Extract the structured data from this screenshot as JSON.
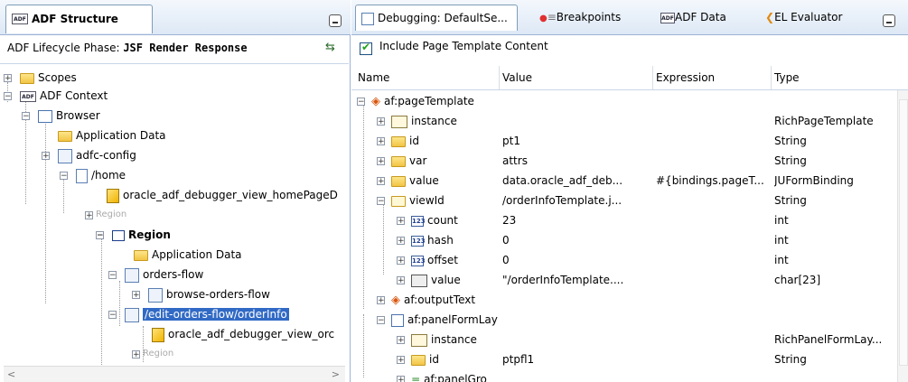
{
  "left_panel": {
    "tab_title": "ADF Structure",
    "phase_label": "ADF Lifecycle Phase:",
    "phase_value": "JSF Render Response",
    "tree": [
      {
        "label": "Scopes"
      },
      {
        "label": "ADF Context"
      },
      {
        "label": "Browser"
      },
      {
        "label": "Application Data"
      },
      {
        "label": "adfc-config"
      },
      {
        "label": "/home"
      },
      {
        "label": "oracle_adf_debugger_view_homePageD"
      },
      {
        "label": "Region"
      },
      {
        "label": "Region"
      },
      {
        "label": "Application Data"
      },
      {
        "label": "orders-flow"
      },
      {
        "label": "browse-orders-flow"
      },
      {
        "label": "/edit-orders-flow/orderInfo"
      },
      {
        "label": "oracle_adf_debugger_view_orc"
      },
      {
        "label": "Region"
      }
    ]
  },
  "right_panel": {
    "tabs": [
      {
        "label": "Debugging: DefaultSe..."
      },
      {
        "label": "Breakpoints"
      },
      {
        "label": "ADF Data"
      },
      {
        "label": "EL Evaluator"
      }
    ],
    "include_label": "Include Page Template Content",
    "columns": {
      "name": "Name",
      "value": "Value",
      "expression": "Expression",
      "type": "Type"
    },
    "rows": [
      {
        "name": "af:pageTemplate",
        "value": "",
        "expression": "",
        "type": ""
      },
      {
        "name": "instance",
        "value": "",
        "expression": "",
        "type": "RichPageTemplate"
      },
      {
        "name": "id",
        "value": "pt1",
        "expression": "",
        "type": "String"
      },
      {
        "name": "var",
        "value": "attrs",
        "expression": "",
        "type": "String"
      },
      {
        "name": "value",
        "value": "data.oracle_adf_deb...",
        "expression": "#{bindings.pageT...",
        "type": "JUFormBinding"
      },
      {
        "name": "viewId",
        "value": "/orderInfoTemplate.j...",
        "expression": "",
        "type": "String"
      },
      {
        "name": "count",
        "value": "23",
        "expression": "",
        "type": "int"
      },
      {
        "name": "hash",
        "value": "0",
        "expression": "",
        "type": "int"
      },
      {
        "name": "offset",
        "value": "0",
        "expression": "",
        "type": "int"
      },
      {
        "name": "value",
        "value": "\"/orderInfoTemplate....",
        "expression": "",
        "type": "char[23]"
      },
      {
        "name": "af:outputText",
        "value": "",
        "expression": "",
        "type": ""
      },
      {
        "name": "af:panelFormLay",
        "value": "",
        "expression": "",
        "type": ""
      },
      {
        "name": "instance",
        "value": "",
        "expression": "",
        "type": "RichPanelFormLay..."
      },
      {
        "name": "id",
        "value": "ptpfl1",
        "expression": "",
        "type": "String"
      },
      {
        "name": "af:panelGro",
        "value": "",
        "expression": "",
        "type": ""
      }
    ]
  },
  "icons": {
    "adf": "adf-icon",
    "minimize": "minimize-icon",
    "toggle": "toggle-tree-icon",
    "folder": "folder-icon",
    "page": "page-icon",
    "region": "region-icon",
    "flow": "taskflow-icon",
    "number": "number-icon",
    "tag": "tag-icon",
    "instance": "instance-icon",
    "chars": "char-array-icon"
  },
  "ui_text": {
    "adf_badge": "ADF",
    "num_badge": "123",
    "toggle_glyph": "⇆",
    "expand_collapsed": "+",
    "expand_open": "−",
    "el_glyph": "❮",
    "scroll_left": "<",
    "scroll_right": ">"
  },
  "colors": {
    "selection": "#316ac5",
    "tab_border": "#7f9db9",
    "accent_orange": "#d9560e"
  }
}
